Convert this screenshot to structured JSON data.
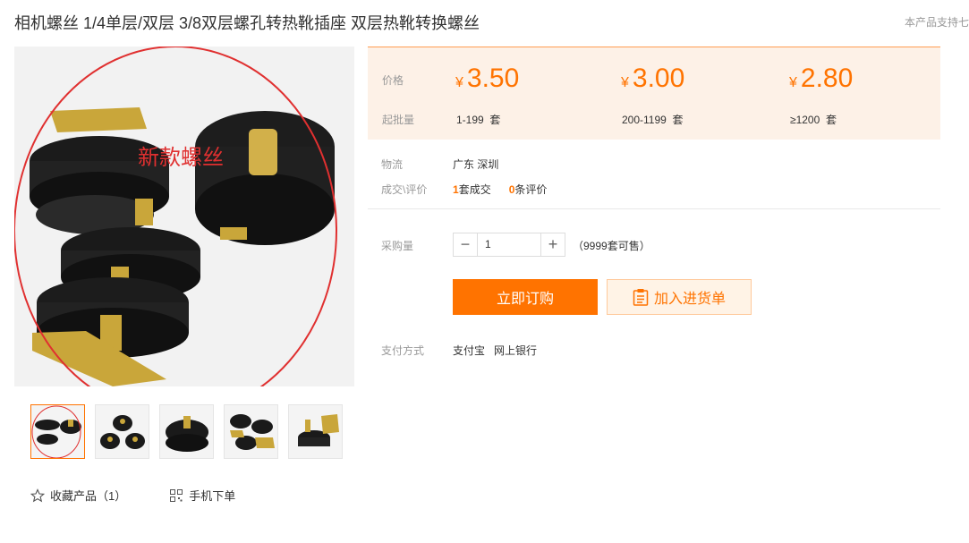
{
  "header": {
    "title": "相机螺丝 1/4单层/双层 3/8双层螺孔转热靴插座 双层热靴转换螺丝",
    "support_text": "本产品支持七"
  },
  "gallery": {
    "main_caption": "新款螺丝",
    "thumb_count": 5
  },
  "prices": {
    "price_label": "价格",
    "moq_label": "起批量",
    "currency": "¥",
    "tiers": [
      {
        "price": "3.50",
        "range": "1-199",
        "unit": "套"
      },
      {
        "price": "3.00",
        "range": "200-1199",
        "unit": "套"
      },
      {
        "price": "2.80",
        "range": "≥1200",
        "unit": "套"
      }
    ]
  },
  "logistics": {
    "label": "物流",
    "value": "广东 深圳"
  },
  "deals": {
    "label": "成交\\评价",
    "deal_count": "1",
    "deal_text": "套成交",
    "review_count": "0",
    "review_text": "条评价"
  },
  "purchase": {
    "label": "采购量",
    "minus": "−",
    "quantity": "1",
    "plus": "+",
    "stock_text": "（9999套可售）"
  },
  "actions": {
    "buy_now": "立即订购",
    "add_to_cart": "加入进货单"
  },
  "payment": {
    "label": "支付方式",
    "methods": [
      "支付宝",
      "网上银行"
    ]
  },
  "bottom": {
    "favorite": "收藏产品（1）",
    "mobile_order": "手机下单"
  },
  "colors": {
    "accent": "#ff7300",
    "price_bg": "#fdf1e7",
    "annotation_red": "#e03030"
  }
}
